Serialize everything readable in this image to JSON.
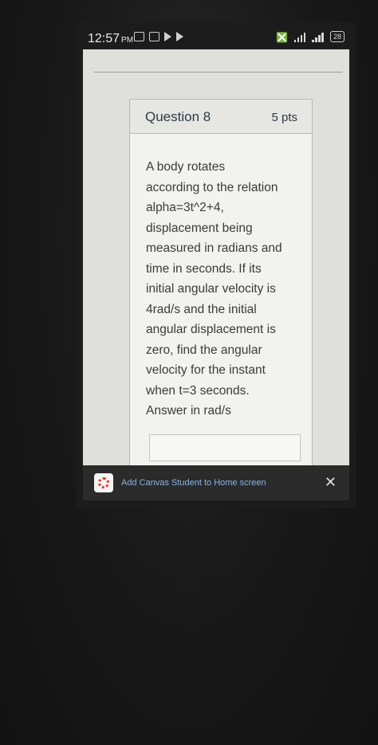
{
  "status_bar": {
    "time": "12:57",
    "ampm": "PM",
    "battery": "28"
  },
  "question": {
    "title": "Question 8",
    "points": "5 pts",
    "body": "A body rotates\naccording to the relation\nalpha=3t^2+4,\ndisplacement being\nmeasured in radians and\ntime in seconds. If its\ninitial angular velocity is\n4rad/s and the initial\nangular displacement is\nzero, find the angular\nvelocity for the instant\nwhen t=3 seconds.\nAnswer in rad/s",
    "answer_value": ""
  },
  "banner": {
    "text": "Add Canvas Student to Home screen",
    "close": "✕"
  },
  "icons": {
    "logo": "canvas-logo-icon",
    "close": "close-icon"
  },
  "colors": {
    "banner_text": "#8ab4e6",
    "logo_ring": "#e03a2f"
  }
}
